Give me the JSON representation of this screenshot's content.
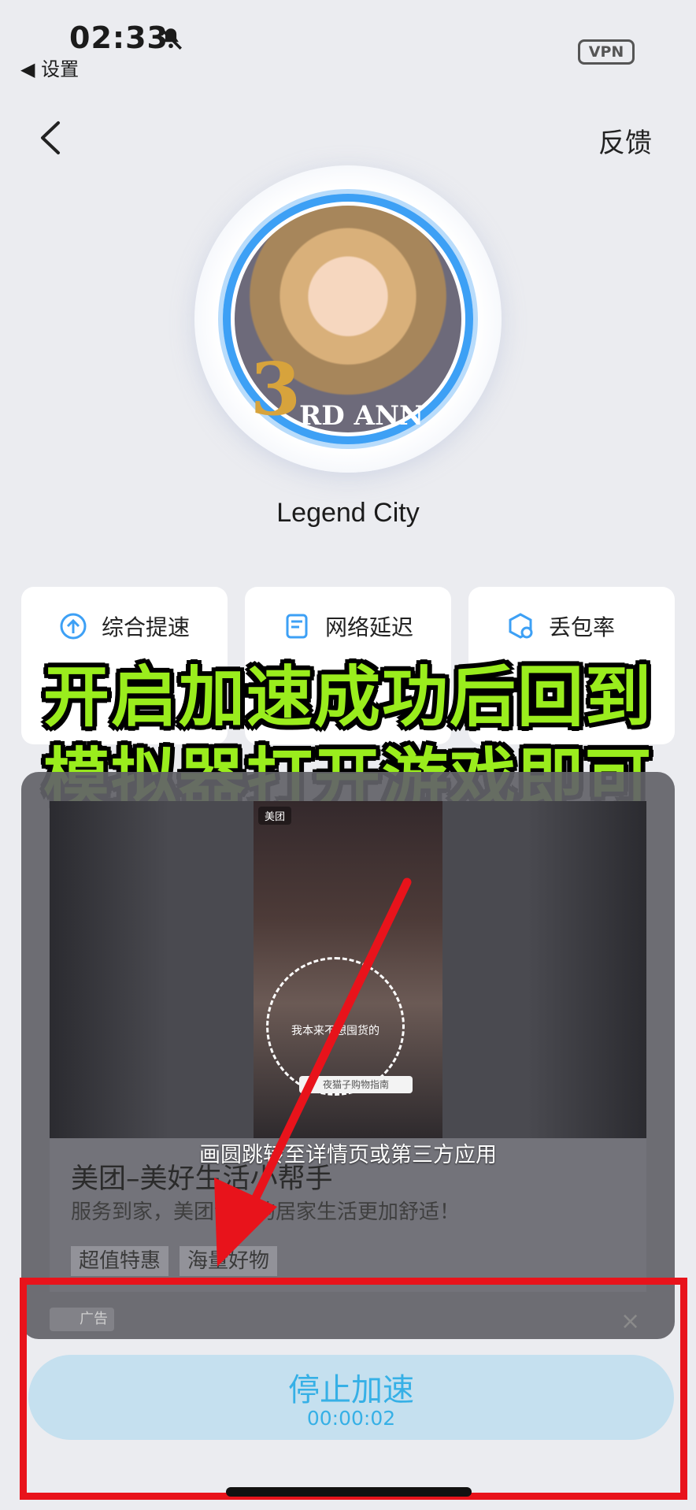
{
  "status_bar": {
    "time": "02:33",
    "back_app": "◀ 设置",
    "vpn": "VPN"
  },
  "nav": {
    "feedback": "反馈"
  },
  "game": {
    "name": "Legend City",
    "avatar_badge": "3",
    "avatar_anni": "RD ANN"
  },
  "stats": [
    {
      "label": "综合提速",
      "icon": "speed-up-icon"
    },
    {
      "label": "网络延迟",
      "icon": "latency-icon"
    },
    {
      "label": "丢包率",
      "icon": "packet-loss-icon"
    }
  ],
  "caption": {
    "line1": "开启加速成功后回到",
    "line2": "模拟器打开游戏即可"
  },
  "ad": {
    "brand_chip": "美团",
    "video_text": "我本来不想囤货的",
    "search_text": "夜猫子购物指南",
    "jump_hint": "画圆跳转至详情页或第三方应用",
    "title": "美团–美好生活小帮手",
    "desc": "服务到家，美团让你的居家生活更加舒适！",
    "tags": [
      "超值特惠",
      "海量好物"
    ],
    "label": "广告",
    "close": "×"
  },
  "stop_button": {
    "label": "停止加速",
    "timer": "00:00:02"
  },
  "colors": {
    "accent": "#36b0e6",
    "annotation_red": "#e8131b",
    "caption_green": "#9aed1d"
  }
}
